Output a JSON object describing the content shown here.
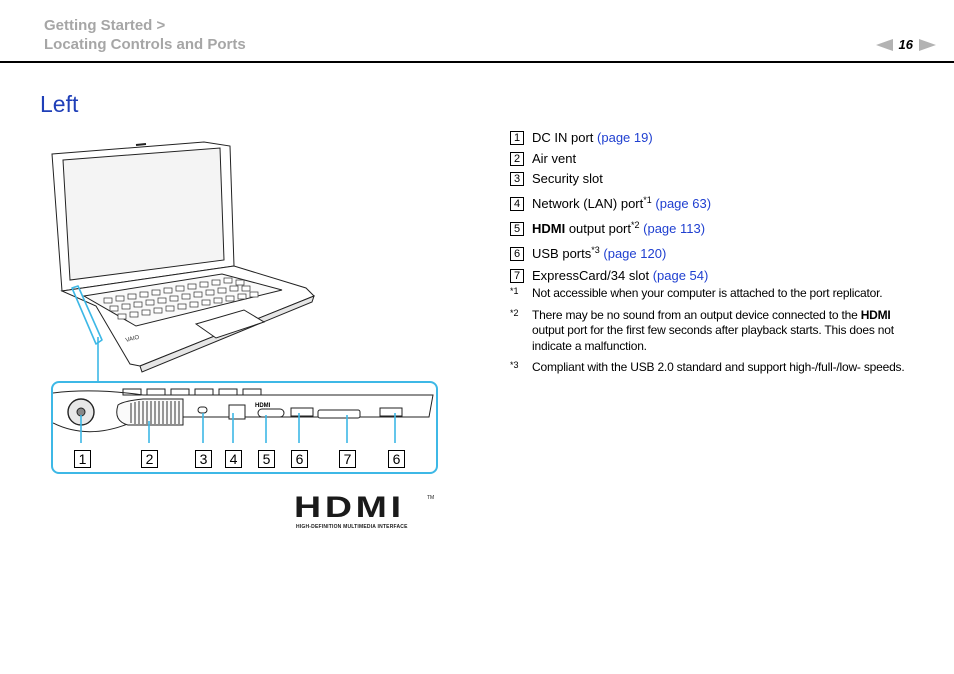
{
  "header": {
    "breadcrumb_line1": "Getting Started >",
    "breadcrumb_line2": "Locating Controls and Ports",
    "page_number": "16",
    "prev_icon": "triangle-left-icon",
    "next_icon": "triangle-right-icon"
  },
  "title": "Left",
  "items": [
    {
      "num": "1",
      "label": "DC IN port",
      "bold": "",
      "sup": "",
      "link": "(page 19)"
    },
    {
      "num": "2",
      "label": "Air vent",
      "bold": "",
      "sup": "",
      "link": ""
    },
    {
      "num": "3",
      "label": "Security slot",
      "bold": "",
      "sup": "",
      "link": ""
    },
    {
      "num": "4",
      "label": "Network (LAN) port",
      "bold": "",
      "sup": "*1",
      "link": "(page 63)"
    },
    {
      "num": "5",
      "label": " output port",
      "bold": "HDMI",
      "sup": "*2",
      "link": "(page 113)"
    },
    {
      "num": "6",
      "label": "USB ports",
      "bold": "",
      "sup": "*3",
      "link": "(page 120)"
    },
    {
      "num": "7",
      "label": "ExpressCard/34 slot",
      "bold": "",
      "sup": "",
      "link": "(page 54)"
    }
  ],
  "notes": [
    {
      "marker": "*1",
      "text_before": "Not accessible when your computer is attached to the port replicator.",
      "bold": "",
      "text_after": ""
    },
    {
      "marker": "*2",
      "text_before": "There may be no sound from an output device connected to the ",
      "bold": "HDMI",
      "text_after": " output port for the first few seconds after playback starts. This does not indicate a malfunction."
    },
    {
      "marker": "*3",
      "text_before": "Compliant with the USB 2.0 standard and support high-/full-/low- speeds.",
      "bold": "",
      "text_after": ""
    }
  ],
  "figure": {
    "callout_labels": [
      "1",
      "2",
      "3",
      "4",
      "5",
      "6",
      "7",
      "6"
    ],
    "callout_color": "#3db8e6",
    "logo_text": "HDMI",
    "logo_tagline": "HIGH-DEFINITION MULTIMEDIA INTERFACE",
    "logo_tm": "TM",
    "brand_mark": "VAIO"
  },
  "colors": {
    "link": "#1f3fd0",
    "title": "#1f3fb8",
    "breadcrumb": "#a6a6a6"
  }
}
